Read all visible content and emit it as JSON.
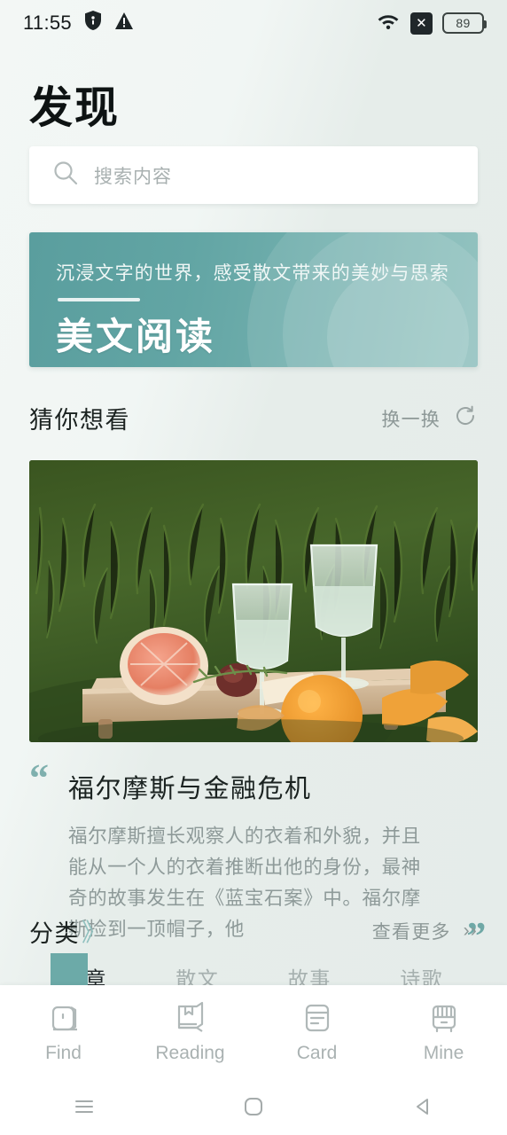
{
  "statusbar": {
    "time": "11:55",
    "battery": "89",
    "icons": [
      "shield-icon",
      "warning-icon",
      "wifi-icon",
      "x-box-icon",
      "battery-icon"
    ]
  },
  "header": {
    "title": "发现"
  },
  "search": {
    "placeholder": "搜索内容",
    "value": "",
    "icon": "search-icon"
  },
  "banner": {
    "subtitle": "沉浸文字的世界，感受散文带来的美妙与思索",
    "title": "美文阅读",
    "color": "#62a5a4"
  },
  "guess": {
    "title": "猜你想看",
    "action_label": "换一换",
    "action_icon": "refresh-icon"
  },
  "recommendation": {
    "image_alt": "picnic-tray-photo",
    "quote_open": "“",
    "quote_close": "”",
    "title": "福尔摩斯与金融危机",
    "description": "福尔摩斯擅长观察人的衣着和外貌，并且能从一个人的衣着推断出他的身份，最神奇的故事发生在《蓝宝石案》中。福尔摩斯捡到一顶帽子，他"
  },
  "categories": {
    "title": "分类",
    "title_chevron": "》",
    "action_label": "查看更多",
    "action_chevron": "››",
    "items": [
      {
        "label": "文章",
        "active": true,
        "badge": "bookmark-ribbon"
      },
      {
        "label": "散文",
        "active": false
      },
      {
        "label": "故事",
        "active": false
      },
      {
        "label": "诗歌",
        "active": false
      }
    ]
  },
  "tabbar": {
    "items": [
      {
        "label": "Find",
        "icon": "compass-icon"
      },
      {
        "label": "Reading",
        "icon": "book-icon"
      },
      {
        "label": "Card",
        "icon": "card-icon"
      },
      {
        "label": "Mine",
        "icon": "bookshelf-icon"
      }
    ]
  },
  "androidnav": {
    "recents_icon": "menu-icon",
    "home_icon": "home-square-icon",
    "back_icon": "back-triangle-icon"
  }
}
